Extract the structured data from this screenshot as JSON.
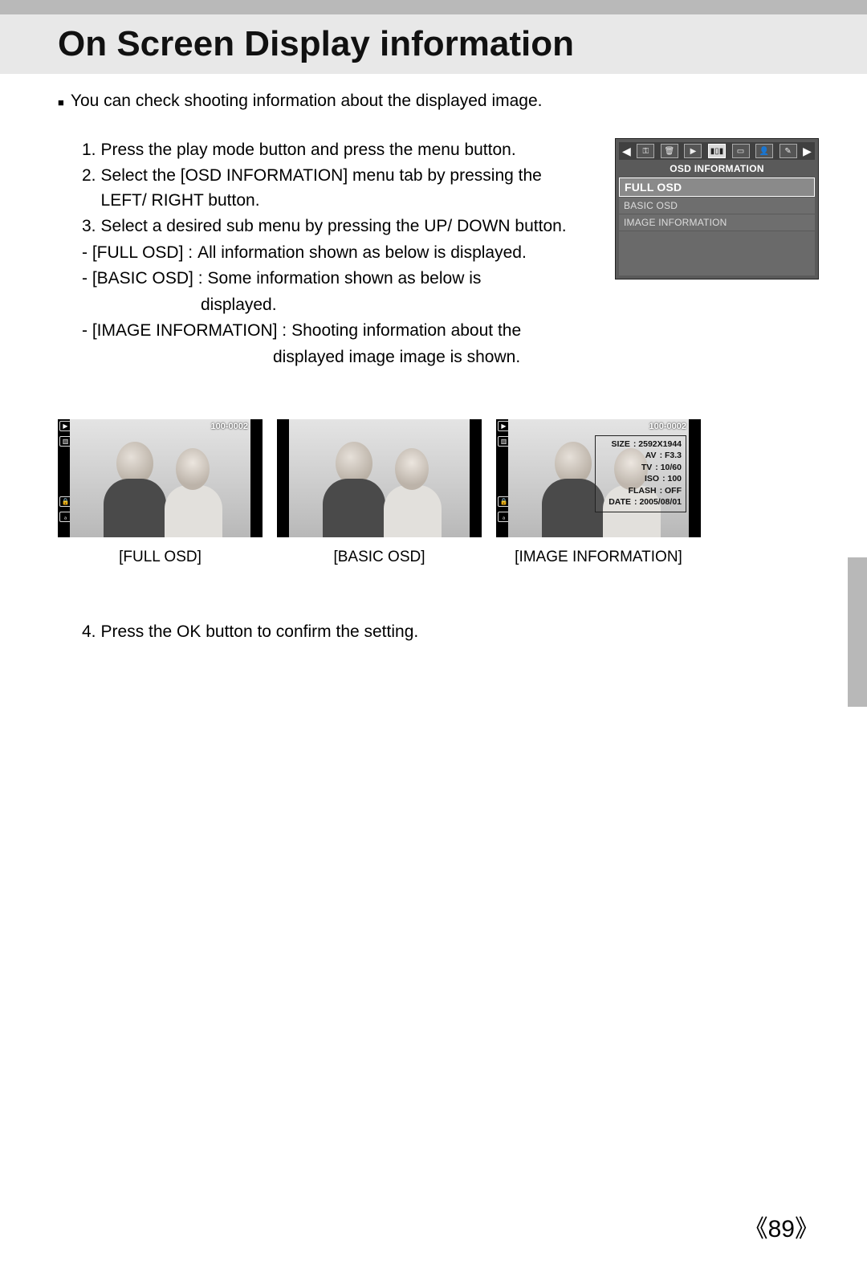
{
  "title": "On Screen Display information",
  "intro": "You can check shooting information about the displayed image.",
  "steps": {
    "s1": "Press the play mode button and press the menu button.",
    "s2": "Select the [OSD INFORMATION] menu tab by pressing the LEFT/ RIGHT button.",
    "s3": "Select a desired sub menu by pressing the UP/ DOWN button.",
    "d1_label": "- [FULL OSD] :",
    "d1_text": "All information shown as below is displayed.",
    "d2_label": "- [BASIC OSD] :",
    "d2_text1": "Some information shown as below is",
    "d2_text2": "displayed.",
    "d3_label": "- [IMAGE INFORMATION] :",
    "d3_text1": "Shooting information about the",
    "d3_text2": "displayed image image is shown.",
    "s4": "Press the OK button to confirm the setting."
  },
  "menu": {
    "title": "OSD INFORMATION",
    "items": [
      "FULL OSD",
      "BASIC OSD",
      "IMAGE INFORMATION"
    ]
  },
  "captions": {
    "full": "[FULL OSD]",
    "basic": "[BASIC OSD]",
    "image": "[IMAGE INFORMATION]"
  },
  "overlay": {
    "file_no": "100-0002",
    "info": {
      "size_label": "SIZE",
      "size": ": 2592X1944",
      "av_label": "AV",
      "av": ": F3.3",
      "tv_label": "TV",
      "tv": ": 10/60",
      "iso_label": "ISO",
      "iso": ": 100",
      "flash_label": "FLASH",
      "flash": ": OFF",
      "date_label": "DATE",
      "date": ": 2005/08/01"
    }
  },
  "page": "《89》"
}
